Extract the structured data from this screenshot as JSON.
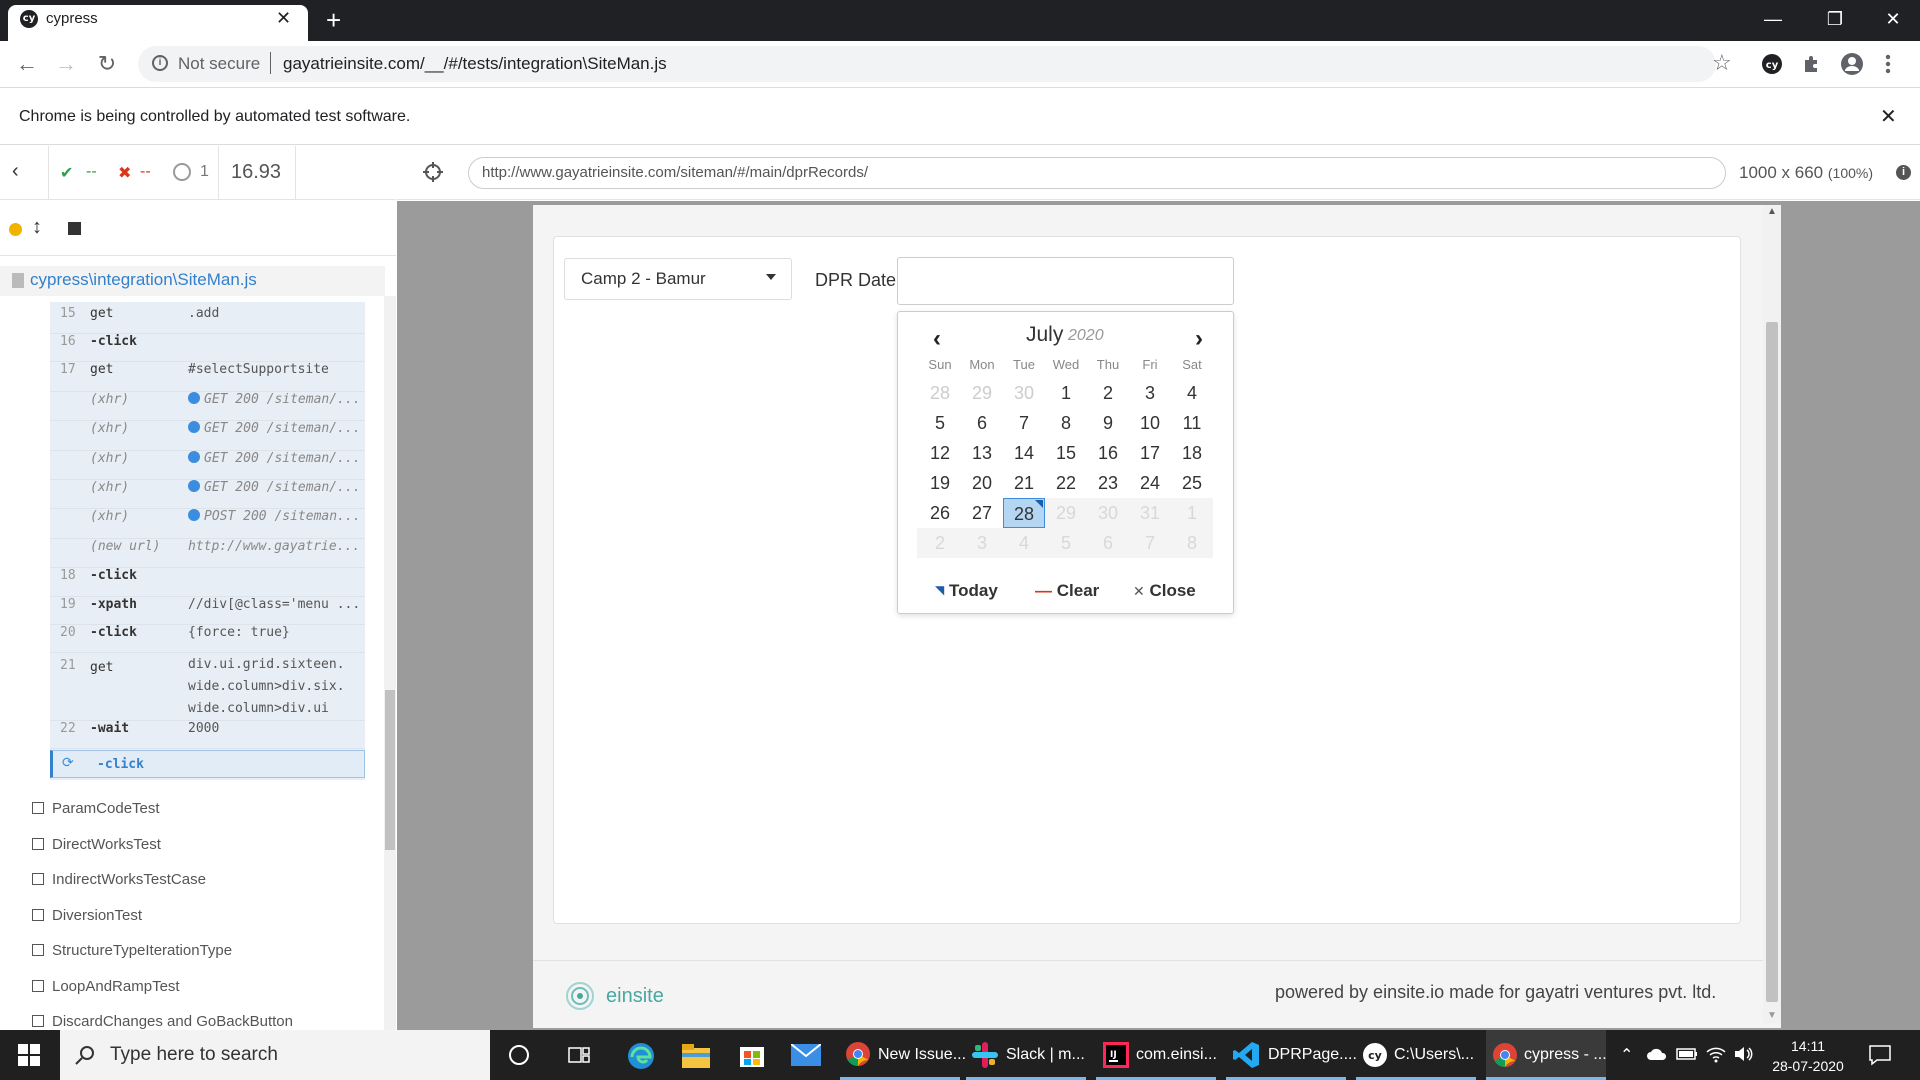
{
  "browser": {
    "tab_title": "cypress",
    "favicon_text": "cy",
    "security_label": "Not secure",
    "address": "gayatrieinsite.com/__/#/tests/integration\\SiteMan.js",
    "infobar_text": "Chrome is being controlled by automated test software.",
    "ext_badge": "cy"
  },
  "reporter": {
    "passed": "--",
    "failed": "--",
    "pending": "1",
    "duration": "16.93",
    "spec_path": "cypress\\integration\\SiteMan.js",
    "commands": [
      {
        "num": "15",
        "name": "get",
        "msg": ".add"
      },
      {
        "num": "16",
        "name": "-click",
        "msg": ""
      },
      {
        "num": "17",
        "name": "get",
        "msg": "#selectSupportsite"
      },
      {
        "num": "",
        "name": "(xhr)",
        "msg": "GET 200 /siteman/..."
      },
      {
        "num": "",
        "name": "(xhr)",
        "msg": "GET 200 /siteman/..."
      },
      {
        "num": "",
        "name": "(xhr)",
        "msg": "GET 200 /siteman/..."
      },
      {
        "num": "",
        "name": "(xhr)",
        "msg": "GET 200 /siteman/..."
      },
      {
        "num": "",
        "name": "(xhr)",
        "msg": "POST 200 /siteman..."
      },
      {
        "num": "",
        "name": "(new url)",
        "msg": "http://www.gayatrie..."
      },
      {
        "num": "18",
        "name": "-click",
        "msg": ""
      },
      {
        "num": "19",
        "name": "-xpath",
        "msg": "//div[@class='menu ..."
      },
      {
        "num": "20",
        "name": "-click",
        "msg": "{force: true}"
      },
      {
        "num": "21",
        "name": "get",
        "msg": "div.ui.grid.sixteen.\nwide.column>div.six.\nwide.column>div.ui"
      },
      {
        "num": "22",
        "name": "-wait",
        "msg": "2000"
      }
    ],
    "active_command": "-click",
    "suites": [
      "ParamCodeTest",
      "DirectWorksTest",
      "IndirectWorksTestCase",
      "DiversionTest",
      "StructureTypeIterationType",
      "LoopAndRampTest",
      "DiscardChanges and GoBackButton"
    ]
  },
  "runner": {
    "aut_url": "http://www.gayatrieinsite.com/siteman/#/main/dprRecords/",
    "viewport": "1000 x 660",
    "scale": "(100%)"
  },
  "app": {
    "camp_selected": "Camp 2 - Bamur",
    "dpr_label": "DPR Date",
    "dpr_value": "",
    "picker": {
      "month": "July",
      "year": "2020",
      "weekdays": [
        "Sun",
        "Mon",
        "Tue",
        "Wed",
        "Thu",
        "Fri",
        "Sat"
      ],
      "weeks": [
        [
          "28",
          "29",
          "30",
          "1",
          "2",
          "3",
          "4"
        ],
        [
          "5",
          "6",
          "7",
          "8",
          "9",
          "10",
          "11"
        ],
        [
          "12",
          "13",
          "14",
          "15",
          "16",
          "17",
          "18"
        ],
        [
          "19",
          "20",
          "21",
          "22",
          "23",
          "24",
          "25"
        ],
        [
          "26",
          "27",
          "28",
          "29",
          "30",
          "31",
          "1"
        ],
        [
          "2",
          "3",
          "4",
          "5",
          "6",
          "7",
          "8"
        ]
      ],
      "selected_day": "28",
      "today_label": "Today",
      "clear_label": "Clear",
      "close_label": "Close"
    },
    "footer_logo": "einsite",
    "footer_text": "powered by einsite.io made for gayatri ventures pvt. ltd."
  },
  "taskbar": {
    "search_placeholder": "Type here to search",
    "apps": [
      {
        "label": "New Issue...",
        "icon": "chrome-icon"
      },
      {
        "label": "Slack | m...",
        "icon": "slack-icon"
      },
      {
        "label": "com.einsi...",
        "icon": "intellij-icon"
      },
      {
        "label": "DPRPage....",
        "icon": "vscode-icon"
      },
      {
        "label": "C:\\Users\\...",
        "icon": "cypress-icon"
      },
      {
        "label": "cypress - ...",
        "icon": "chrome-icon"
      }
    ],
    "time": "14:11",
    "date": "28-07-2020"
  },
  "colors": {
    "accent_blue": "#3b8de0",
    "pass_green": "#2e9e4f",
    "fail_red": "#d9361e",
    "logo_teal": "#4aa7a0"
  }
}
